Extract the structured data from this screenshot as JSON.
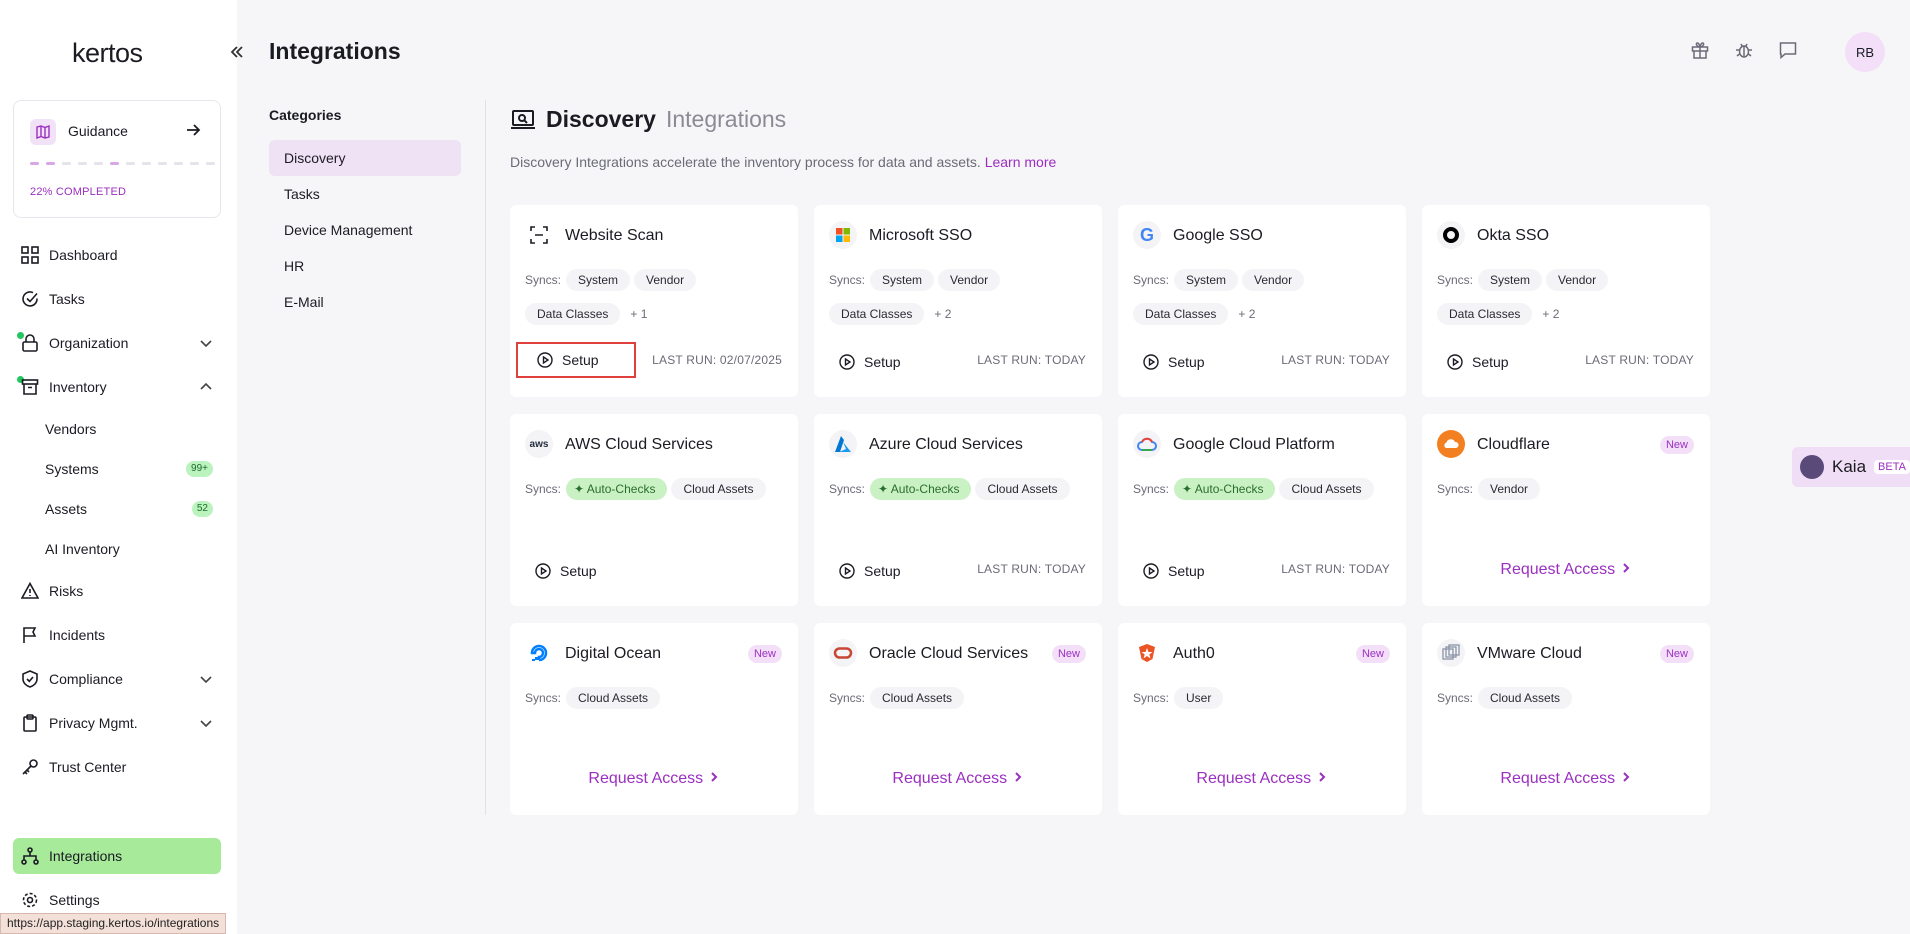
{
  "sidebar": {
    "logo": "kertos",
    "guidance": {
      "label": "Guidance",
      "progress": "22% COMPLETED",
      "progress_fraction": 0.22
    },
    "nav": {
      "dashboard": "Dashboard",
      "tasks": "Tasks",
      "organization": "Organization",
      "inventory": "Inventory",
      "vendors": "Vendors",
      "systems": "Systems",
      "systems_badge": "99+",
      "assets": "Assets",
      "assets_badge": "52",
      "ai_inventory": "AI Inventory",
      "risks": "Risks",
      "incidents": "Incidents",
      "compliance": "Compliance",
      "privacy": "Privacy Mgmt.",
      "trust_center": "Trust Center",
      "integrations": "Integrations",
      "settings": "Settings"
    },
    "status_url": "https://app.staging.kertos.io/integrations"
  },
  "header": {
    "title": "Integrations",
    "avatar": "RB"
  },
  "categories": {
    "title": "Categories",
    "items": [
      "Discovery",
      "Tasks",
      "Device Management",
      "HR",
      "E-Mail"
    ],
    "active": "Discovery"
  },
  "main": {
    "title_bold": "Discovery",
    "title_light": "Integrations",
    "description": "Discovery Integrations accelerate the inventory process for data and assets.",
    "learn_more": "Learn more",
    "syncs_label": "Syncs:",
    "setup_label": "Setup",
    "request_label": "Request Access",
    "new_label": "New",
    "cards": [
      {
        "title": "Website Scan",
        "last_run": "LAST RUN: 02/07/2025"
      },
      {
        "title": "Microsoft SSO",
        "last_run": "LAST RUN: TODAY"
      },
      {
        "title": "Google SSO",
        "last_run": "LAST RUN: TODAY"
      },
      {
        "title": "Okta SSO",
        "last_run": "LAST RUN: TODAY"
      },
      {
        "title": "AWS Cloud Services"
      },
      {
        "title": "Azure Cloud Services",
        "last_run": "LAST RUN: TODAY"
      },
      {
        "title": "Google Cloud Platform",
        "last_run": "LAST RUN: TODAY"
      },
      {
        "title": "Cloudflare"
      },
      {
        "title": "Digital Ocean"
      },
      {
        "title": "Oracle Cloud Services"
      },
      {
        "title": "Auth0"
      },
      {
        "title": "VMware Cloud"
      }
    ],
    "pills": {
      "system": "System",
      "vendor": "Vendor",
      "data_classes": "Data Classes",
      "plus1": "+ 1",
      "plus2": "+ 2",
      "auto_checks": "Auto-Checks",
      "cloud_assets": "Cloud Assets",
      "user": "User"
    }
  },
  "kaia": {
    "name": "Kaia",
    "beta": "BETA"
  }
}
